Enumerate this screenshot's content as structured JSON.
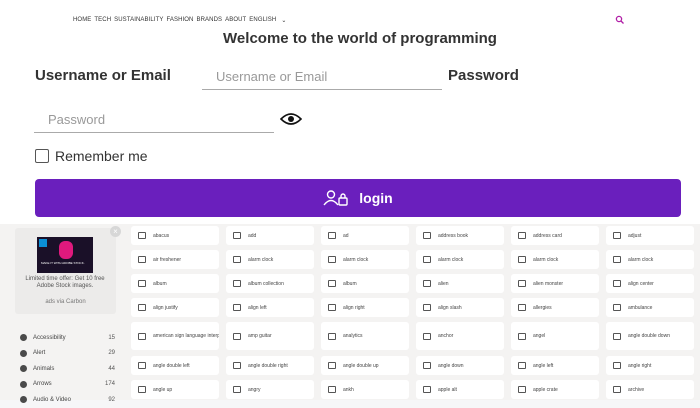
{
  "nav": {
    "links": [
      "HOME",
      "TECH",
      "SUSTAINABILITY",
      "FASHION",
      "BRANDS",
      "ABOUT",
      "ENGLISH"
    ],
    "language_chevron": "chevron-down-icon",
    "search_icon": "search-icon"
  },
  "welcome_text": "Welcome to the world of programming",
  "form": {
    "username_label": "Username or Email",
    "username_placeholder": "Username or Email",
    "password_label": "Password",
    "password_placeholder": "Password",
    "remember_label": "Remember me",
    "login_label": "login",
    "accent_color": "#6a1fbd"
  },
  "ad": {
    "thumb_text": "MAKE IT WITH ADOBE STOCK.",
    "caption": "Limited time offer: Get 10 free Adobe Stock images.",
    "via": "ads via Carbon"
  },
  "categories": [
    {
      "name": "Accessibility",
      "count": "15"
    },
    {
      "name": "Alert",
      "count": "29"
    },
    {
      "name": "Animals",
      "count": "44"
    },
    {
      "name": "Arrows",
      "count": "174"
    },
    {
      "name": "Audio & Video",
      "count": "92"
    }
  ],
  "icons": [
    "abacus",
    "add",
    "ad",
    "address book",
    "address card",
    "adjust",
    "air freshener",
    "alarm clock",
    "alarm clock",
    "alarm clock",
    "alarm clock",
    "alarm clock",
    "album",
    "album collection",
    "album",
    "alien",
    "alien monster",
    "align center",
    "align justify",
    "align left",
    "align right",
    "align slash",
    "allergies",
    "ambulance",
    "american sign language interpreting",
    "amp guitar",
    "analytics",
    "anchor",
    "angel",
    "angle double down",
    "angle double left",
    "angle double right",
    "angle double up",
    "angle down",
    "angle left",
    "angle right",
    "angle up",
    "angry",
    "ankh",
    "apple alt",
    "apple crate",
    "archive"
  ]
}
